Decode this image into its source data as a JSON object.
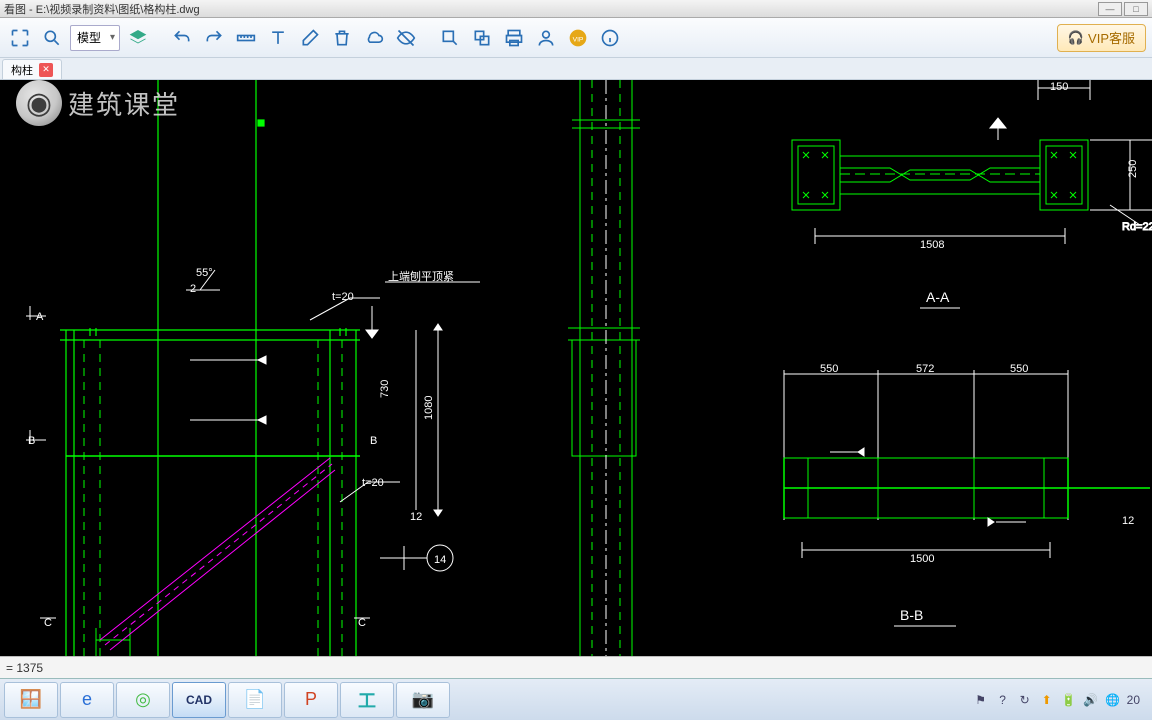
{
  "title": "看图 - E:\\视频录制资料\\图纸\\格构柱.dwg",
  "toolbar": {
    "model": "模型",
    "vip": "VIP客服"
  },
  "tab": {
    "name": "构柱"
  },
  "watermark": "建筑课堂",
  "cmd": "= 1375",
  "tray": {
    "time": "20"
  },
  "drawing": {
    "sectionAA": "A-A",
    "sectionBB": "B-B",
    "markA": "A",
    "markB": "B",
    "markC": "C",
    "angle55": "55°",
    "note2": "2",
    "noteTop": "上端刨平顶紧",
    "t20a": "t=20",
    "t20b": "t=20",
    "dim1080": "1080",
    "dim12": "12",
    "bubble14": "14",
    "dim150": "150",
    "dim1508": "1508",
    "dim1500": "1500",
    "dim550a": "550",
    "dim572": "572",
    "dim550b": "550",
    "rd22": "Rd=22",
    "dim250": "250",
    "dim730": "730"
  }
}
